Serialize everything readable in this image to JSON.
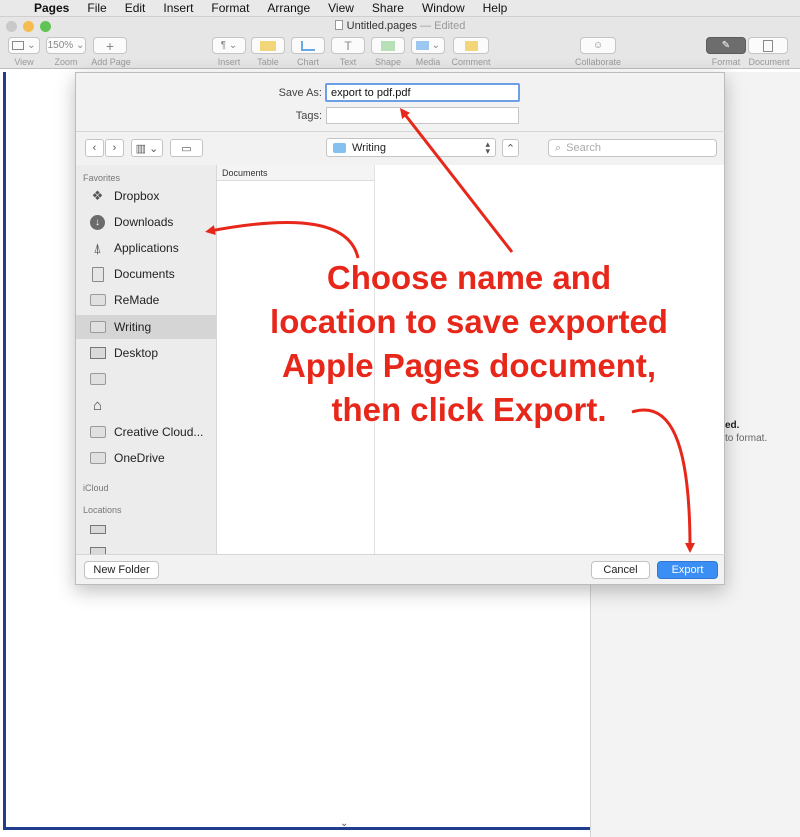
{
  "menubar": {
    "items": [
      "Pages",
      "File",
      "Edit",
      "Insert",
      "Format",
      "Arrange",
      "View",
      "Share",
      "Window",
      "Help"
    ]
  },
  "window": {
    "title": "Untitled.pages",
    "status": "— Edited"
  },
  "toolbar": {
    "zoom_value": "150%",
    "labels": {
      "view": "View",
      "zoom": "Zoom",
      "add_page": "Add Page",
      "insert": "Insert",
      "table": "Table",
      "chart": "Chart",
      "text": "Text",
      "shape": "Shape",
      "media": "Media",
      "comment": "Comment",
      "collaborate": "Collaborate",
      "format": "Format",
      "document": "Document"
    }
  },
  "dialog": {
    "save_as_label": "Save As:",
    "save_as_value": "export to pdf.pdf",
    "tags_label": "Tags:",
    "tags_value": "",
    "location": "Writing",
    "search_placeholder": "Search",
    "sidebar": {
      "favorites_header": "Favorites",
      "favorites": [
        {
          "label": "Dropbox",
          "icon": "dropbox-icon"
        },
        {
          "label": "Downloads",
          "icon": "downloads-icon"
        },
        {
          "label": "Applications",
          "icon": "applications-icon"
        },
        {
          "label": "Documents",
          "icon": "documents-icon"
        },
        {
          "label": "ReMade",
          "icon": "folder-icon"
        },
        {
          "label": "Writing",
          "icon": "folder-icon",
          "selected": true
        },
        {
          "label": "Desktop",
          "icon": "desktop-icon"
        },
        {
          "label": "",
          "icon": "folder-icon"
        },
        {
          "label": "",
          "icon": "home-icon"
        },
        {
          "label": "Creative Cloud...",
          "icon": "folder-icon"
        },
        {
          "label": "OneDrive",
          "icon": "folder-icon"
        }
      ],
      "icloud_header": "iCloud",
      "locations_header": "Locations"
    },
    "column_header": "Documents",
    "new_folder_label": "New Folder",
    "cancel_label": "Cancel",
    "export_label": "Export"
  },
  "inspector_fragment": {
    "line1": "ed.",
    "line2": "to format."
  },
  "annotation": {
    "lines": [
      "Choose name and",
      "location to save exported",
      "Apple Pages document,",
      "then click Export."
    ],
    "color": "#e8271b"
  },
  "colors": {
    "accent": "#3a8ef4",
    "selection": "#d5d5d5",
    "document_border": "#1f3e8e"
  }
}
